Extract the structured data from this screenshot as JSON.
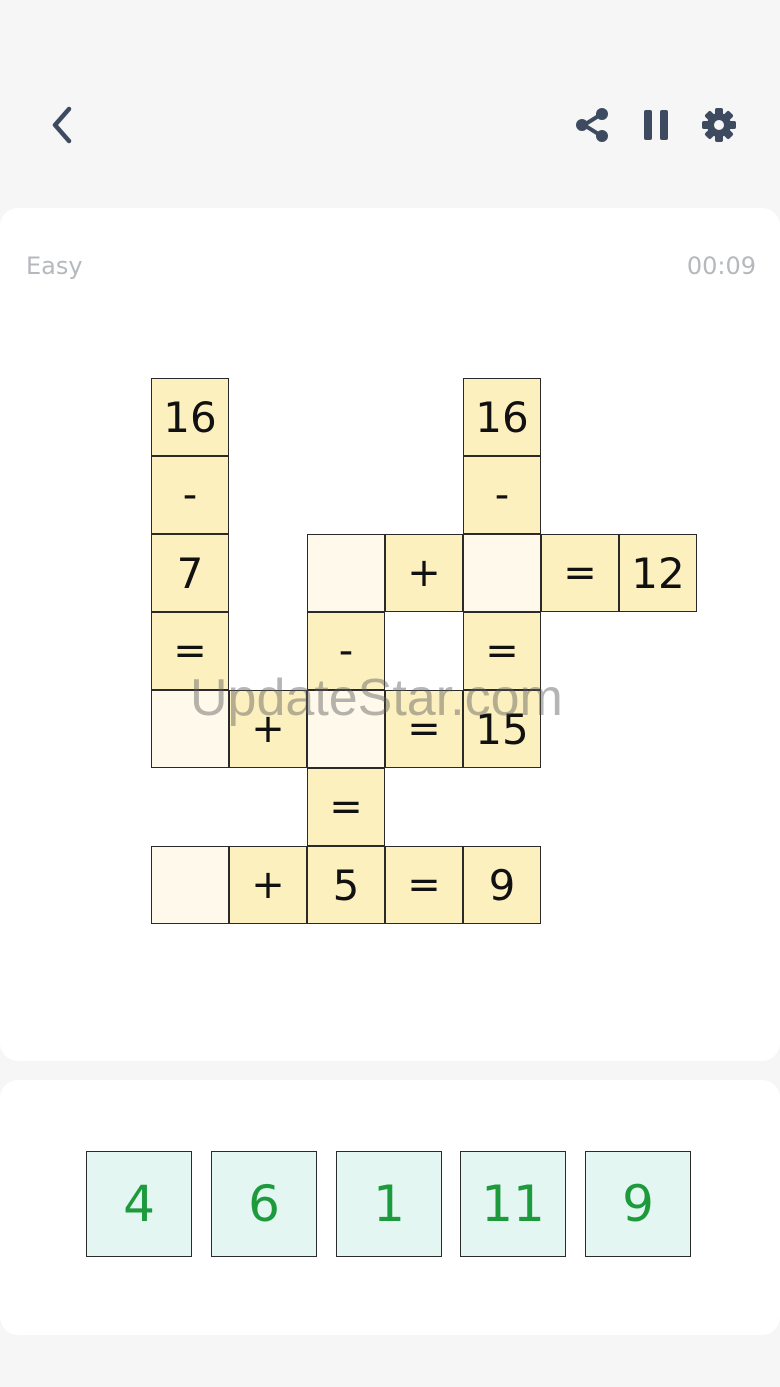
{
  "header": {
    "back_icon": "chevron-left-icon",
    "share_icon": "share-icon",
    "pause_icon": "pause-icon",
    "settings_icon": "gear-icon"
  },
  "game": {
    "difficulty": "Easy",
    "timer": "00:09"
  },
  "watermark": "UpdateStar.com",
  "grid": {
    "cells": [
      {
        "col": 0,
        "row": 0,
        "text": "16",
        "kind": "num"
      },
      {
        "col": 0,
        "row": 1,
        "text": "-",
        "kind": "op"
      },
      {
        "col": 0,
        "row": 2,
        "text": "7",
        "kind": "num"
      },
      {
        "col": 0,
        "row": 3,
        "text": "=",
        "kind": "op"
      },
      {
        "col": 0,
        "row": 4,
        "text": "",
        "kind": "blank"
      },
      {
        "col": 1,
        "row": 4,
        "text": "+",
        "kind": "op"
      },
      {
        "col": 2,
        "row": 2,
        "text": "",
        "kind": "blank"
      },
      {
        "col": 3,
        "row": 2,
        "text": "+",
        "kind": "op"
      },
      {
        "col": 4,
        "row": 0,
        "text": "16",
        "kind": "num"
      },
      {
        "col": 4,
        "row": 1,
        "text": "-",
        "kind": "op"
      },
      {
        "col": 4,
        "row": 2,
        "text": "",
        "kind": "blank"
      },
      {
        "col": 5,
        "row": 2,
        "text": "=",
        "kind": "op"
      },
      {
        "col": 6,
        "row": 2,
        "text": "12",
        "kind": "num"
      },
      {
        "col": 2,
        "row": 3,
        "text": "-",
        "kind": "op"
      },
      {
        "col": 4,
        "row": 3,
        "text": "=",
        "kind": "op"
      },
      {
        "col": 2,
        "row": 4,
        "text": "",
        "kind": "blank"
      },
      {
        "col": 3,
        "row": 4,
        "text": "=",
        "kind": "op"
      },
      {
        "col": 4,
        "row": 4,
        "text": "15",
        "kind": "num"
      },
      {
        "col": 2,
        "row": 5,
        "text": "=",
        "kind": "op"
      },
      {
        "col": 0,
        "row": 6,
        "text": "",
        "kind": "blank"
      },
      {
        "col": 1,
        "row": 6,
        "text": "+",
        "kind": "op"
      },
      {
        "col": 2,
        "row": 6,
        "text": "5",
        "kind": "num"
      },
      {
        "col": 3,
        "row": 6,
        "text": "=",
        "kind": "op"
      },
      {
        "col": 4,
        "row": 6,
        "text": "9",
        "kind": "num"
      }
    ]
  },
  "tray": {
    "tiles": [
      "4",
      "6",
      "1",
      "11",
      "9"
    ]
  },
  "colors": {
    "cell_fill": "#fdf0bf",
    "blank_fill": "#fff9eb",
    "tile_fill": "#e4f6f2",
    "tile_text": "#1c9a3c",
    "icon_color": "#3d4a5f"
  }
}
